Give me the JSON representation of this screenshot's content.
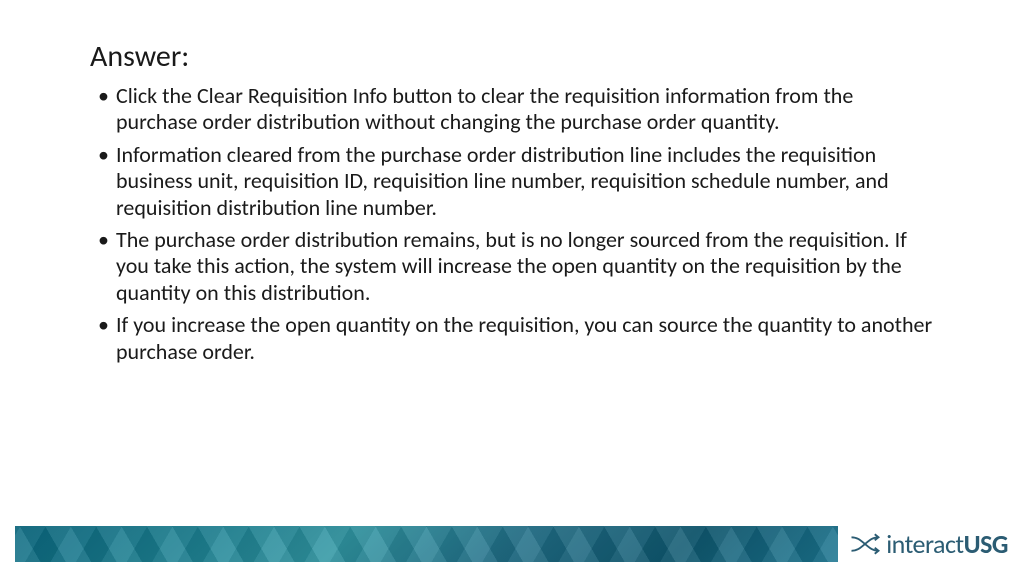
{
  "title": "Answer:",
  "bullets": [
    "Click the Clear Requisition Info button to clear the requisition information from the purchase order distribution without changing the purchase order quantity.",
    "Information cleared from the purchase order distribution line includes the requisition business unit, requisition ID, requisition line number, requisition schedule number, and requisition distribution line number.",
    "The purchase order distribution remains, but is no longer sourced from the requisition. If you take this action, the system will increase the open quantity on the requisition by the quantity on this distribution.",
    "If you increase the open quantity on the requisition, you can source the quantity to another purchase order."
  ],
  "footer": {
    "logo_prefix": "interact",
    "logo_suffix": "USG"
  }
}
